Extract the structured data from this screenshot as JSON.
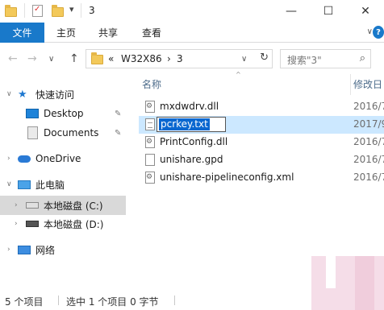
{
  "window": {
    "title": "3",
    "minimize_glyph": "—",
    "maximize_glyph": "☐",
    "close_glyph": "✕",
    "quick_access_dropdown": "▾"
  },
  "ribbon": {
    "tabs": [
      {
        "label": "文件",
        "active": true
      },
      {
        "label": "主页"
      },
      {
        "label": "共享"
      },
      {
        "label": "查看"
      }
    ],
    "expand_glyph": "∨",
    "help_glyph": "?"
  },
  "address": {
    "back_glyph": "←",
    "forward_glyph": "→",
    "recent_glyph": "∨",
    "up_glyph": "↑",
    "overflow": "«",
    "crumbs": [
      "W32X86",
      "3"
    ],
    "crumb_sep": "›",
    "dropdown_glyph": "∨",
    "refresh_glyph": "↻",
    "search_placeholder": "搜索\"3\"",
    "search_glyph": "⌕"
  },
  "nav": {
    "quick_access": "快速访问",
    "desktop": "Desktop",
    "documents": "Documents",
    "onedrive": "OneDrive",
    "this_pc": "此电脑",
    "drive_c": "本地磁盘 (C:)",
    "drive_d": "本地磁盘 (D:)",
    "network": "网络",
    "pin_glyph": "📌",
    "expand_glyph": "›",
    "expanded_glyph": "∨"
  },
  "files": {
    "col_name": "名称",
    "col_modified": "修改日",
    "sort_glyph": "^",
    "rows": [
      {
        "name": "mxdwdrv.dll",
        "date": "2016/7",
        "icon": "gear"
      },
      {
        "name": "pcrkey.txt",
        "date": "2017/9",
        "icon": "txt",
        "selected": true,
        "renaming": true
      },
      {
        "name": "PrintConfig.dll",
        "date": "2016/7",
        "icon": "gear"
      },
      {
        "name": "unishare.gpd",
        "date": "2016/7",
        "icon": "file"
      },
      {
        "name": "unishare-pipelineconfig.xml",
        "date": "2016/7",
        "icon": "gear"
      }
    ]
  },
  "status": {
    "count": "5 个项目",
    "selected": "选中 1 个项目  0 字节"
  },
  "watermark": {
    "text": "XP"
  },
  "colors": {
    "accent": "#1979ca",
    "selection": "#cce8ff",
    "nav_selection": "#d9d9d9",
    "text_highlight": "#0a67d0"
  }
}
